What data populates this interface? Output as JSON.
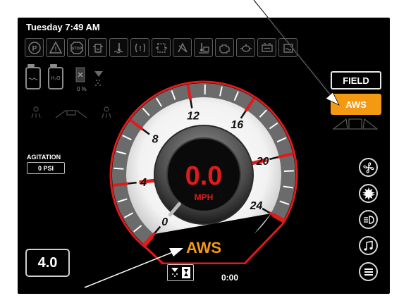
{
  "header": {
    "datetime": "Tuesday 7:49 AM"
  },
  "warning_icons": [
    {
      "name": "parking-brake-icon",
      "glyph": "P"
    },
    {
      "name": "warning-triangle-icon",
      "glyph": "!"
    },
    {
      "name": "stop-icon",
      "glyph": "STOP"
    },
    {
      "name": "hydraulic-filter-icon",
      "glyph": ""
    },
    {
      "name": "coolant-temp-icon",
      "glyph": ""
    },
    {
      "name": "transmission-warning-icon",
      "glyph": ""
    },
    {
      "name": "transmission-filter-icon",
      "glyph": ""
    },
    {
      "name": "traction-control-icon",
      "glyph": ""
    },
    {
      "name": "hydraulic-temp-icon",
      "glyph": ""
    },
    {
      "name": "engine-warning-icon",
      "glyph": ""
    },
    {
      "name": "oil-pressure-icon",
      "glyph": ""
    },
    {
      "name": "battery-charge-icon",
      "glyph": ""
    },
    {
      "name": "water-in-fuel-icon",
      "glyph": ""
    }
  ],
  "tanks": {
    "product_tank_icon": "product-tank-icon",
    "water_tank_label": "H₂O",
    "rinse_percent": "0 %"
  },
  "agitation": {
    "label": "AGITATION",
    "value": "0 PSI"
  },
  "speedometer": {
    "speed": "0.0",
    "unit": "MPH",
    "min": 0,
    "max": 24,
    "major_ticks": [
      "0",
      "4",
      "8",
      "12",
      "16",
      "20",
      "24"
    ],
    "current_value": 0,
    "mode_label": "AWS",
    "colors": {
      "accent_red": "#e01b1b",
      "mode_orange": "#f39a12"
    }
  },
  "steering": {
    "field_label": "FIELD",
    "aws_label": "AWS"
  },
  "gear": {
    "value": "4.0"
  },
  "timer": {
    "value": "0:00"
  },
  "right_buttons": [
    {
      "name": "fan-icon"
    },
    {
      "name": "work-lights-icon"
    },
    {
      "name": "headlights-icon"
    },
    {
      "name": "music-icon"
    },
    {
      "name": "menu-icon"
    }
  ]
}
